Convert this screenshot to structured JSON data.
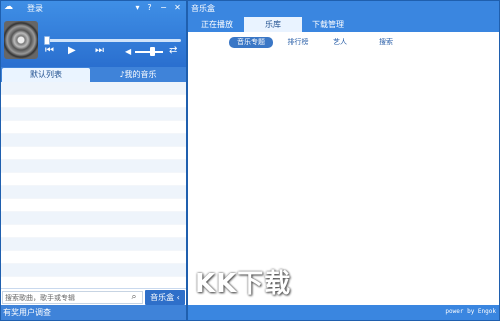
{
  "left_panel": {
    "title": "登录",
    "titlebar_buttons": [
      "▾",
      "?",
      "−",
      "✕"
    ],
    "tabs": {
      "default_list": "默认列表",
      "my_music": "我的音乐"
    },
    "search": {
      "placeholder": "搜索歌曲，歌手或专辑"
    },
    "music_box_button": "音乐盒 ‹",
    "status_text": "有奖用户调查"
  },
  "right_panel": {
    "title": "音乐盒",
    "tabs": [
      "正在播放",
      "乐库",
      "下载管理"
    ],
    "active_tab": 1,
    "subnav": [
      "音乐专题",
      "排行榜",
      "艺人",
      "搜索"
    ],
    "active_subnav": 0,
    "credit": "power by Engok"
  },
  "watermark": "KK下载",
  "colors": {
    "brand_blue": "#3a86e0",
    "dark_blue": "#1f5fae",
    "light_blue": "#eaf4ff"
  }
}
